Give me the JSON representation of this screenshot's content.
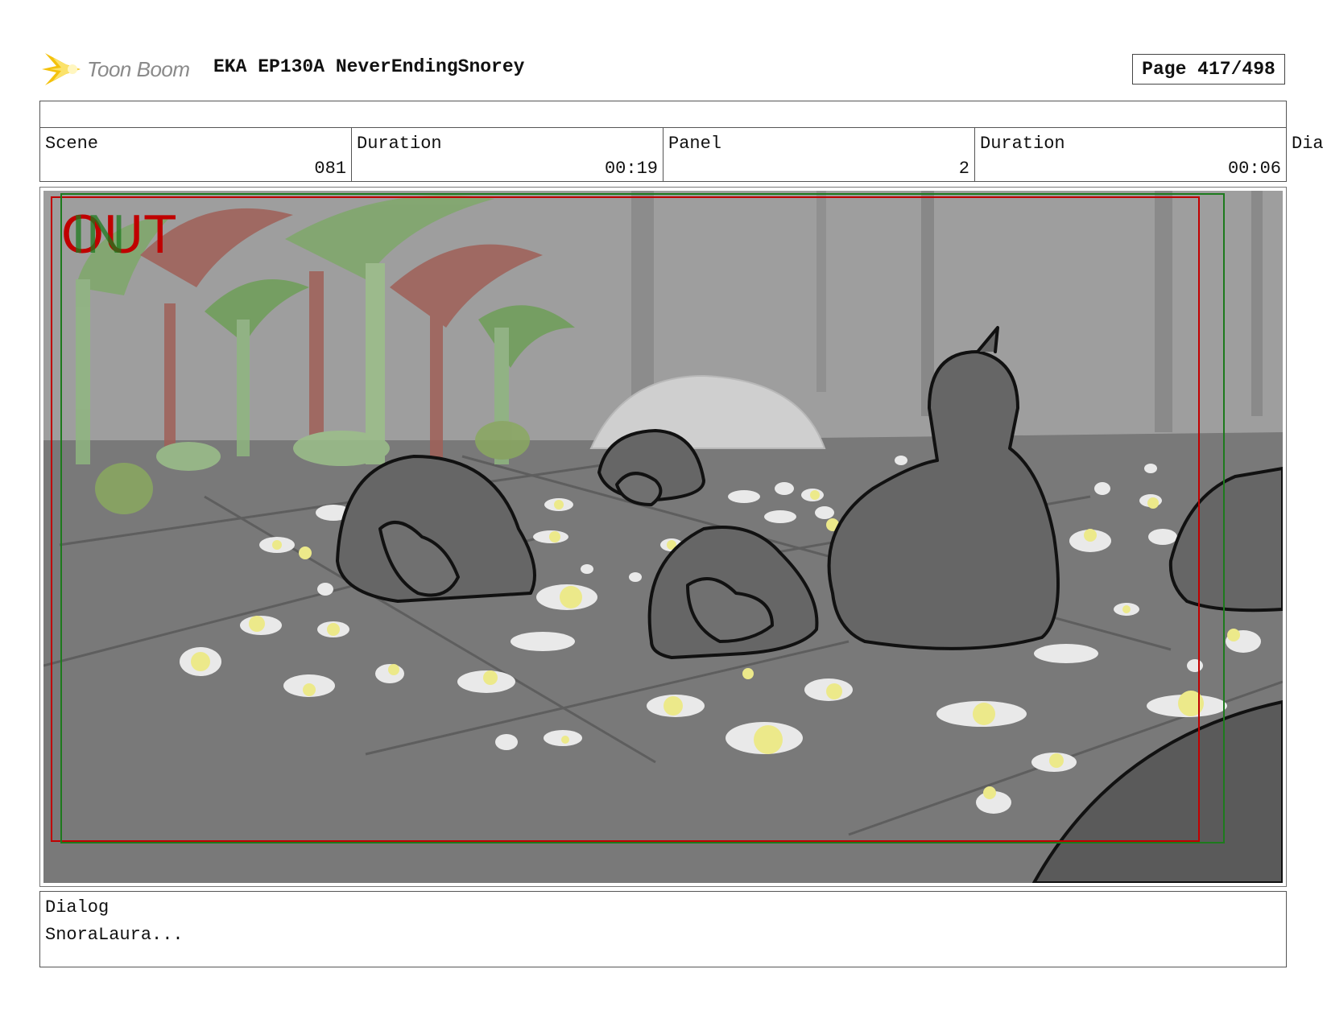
{
  "header": {
    "logo_text": "Toon Boom",
    "title": "EKA EP130A NeverEndingSnorey",
    "page": "Page 417/498"
  },
  "info": {
    "scene_label": "Scene",
    "scene_value": "081",
    "scene_duration_label": "Duration",
    "scene_duration_value": "00:19",
    "panel_label": "Panel",
    "panel_value": "2",
    "panel_duration_label": "Duration",
    "panel_duration_value": "00:06",
    "extra_label": "Dia"
  },
  "panel": {
    "camera_marker_out": "OUT",
    "camera_marker_in": "IN",
    "colors": {
      "out_frame": "#c00000",
      "in_frame": "#1d7a1d"
    }
  },
  "dialog": {
    "label": "Dialog",
    "text": "SnoraLaura..."
  }
}
